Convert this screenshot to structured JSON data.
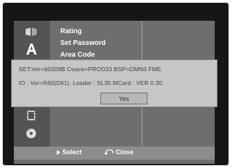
{
  "menu": {
    "items": [
      {
        "label": "Rating"
      },
      {
        "label": "Set Password"
      },
      {
        "label": "Area Code"
      }
    ]
  },
  "icons": [
    "disc-tab-icon",
    "language-tab-icon",
    "film-tab-icon",
    "audio-disc-tab-icon"
  ],
  "dialog": {
    "line1": "SET:Ver=60309B Cware=PROD33 BSP=DMN3 FME",
    "line2": "IO : Ver=R60(D61).  Loader : SL35   MCard : VER 0.30",
    "yes_label": "Yes"
  },
  "footer": {
    "select_label": "Select",
    "close_label": "Close"
  },
  "colors": {
    "screen_bg": "#161616",
    "panel": "#6e6e6e",
    "icon_column": "#545454",
    "dialog_bg": "#c6c6c6",
    "footer_bg": "#8c8c8c",
    "text": "#ffffff"
  }
}
